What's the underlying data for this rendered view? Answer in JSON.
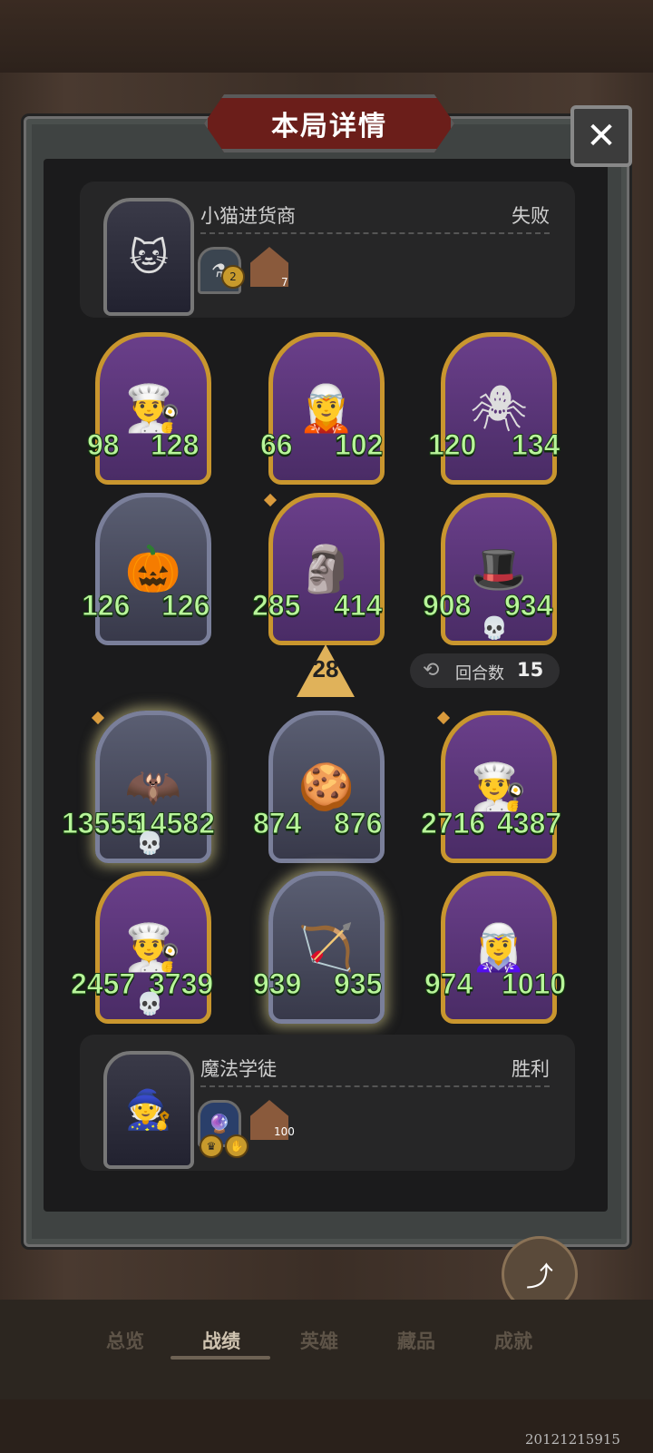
{
  "title": "本局详情",
  "close_symbol": "✕",
  "top_player": {
    "name": "小猫进货商",
    "result": "失败",
    "item_level": "2",
    "house_count": "7"
  },
  "enemy_heroes": [
    {
      "atk": "98",
      "hp": "128"
    },
    {
      "atk": "66",
      "hp": "102"
    },
    {
      "atk": "120",
      "hp": "134"
    },
    {
      "atk": "126",
      "hp": "126"
    },
    {
      "atk": "285",
      "hp": "414"
    },
    {
      "atk": "908",
      "hp": "934"
    }
  ],
  "level": "28",
  "round": {
    "label": "回合数",
    "value": "15"
  },
  "my_heroes": [
    {
      "atk": "13555",
      "hp": "14582"
    },
    {
      "atk": "874",
      "hp": "876"
    },
    {
      "atk": "2716",
      "hp": "4387"
    },
    {
      "atk": "2457",
      "hp": "3739"
    },
    {
      "atk": "939",
      "hp": "935"
    },
    {
      "atk": "974",
      "hp": "1010"
    }
  ],
  "bottom_player": {
    "name": "魔法学徒",
    "result": "胜利",
    "house_count": "100"
  },
  "share_label": "分享",
  "tabs": [
    "总览",
    "战绩",
    "英雄",
    "藏品",
    "成就"
  ],
  "bottom_id": "20121215915"
}
